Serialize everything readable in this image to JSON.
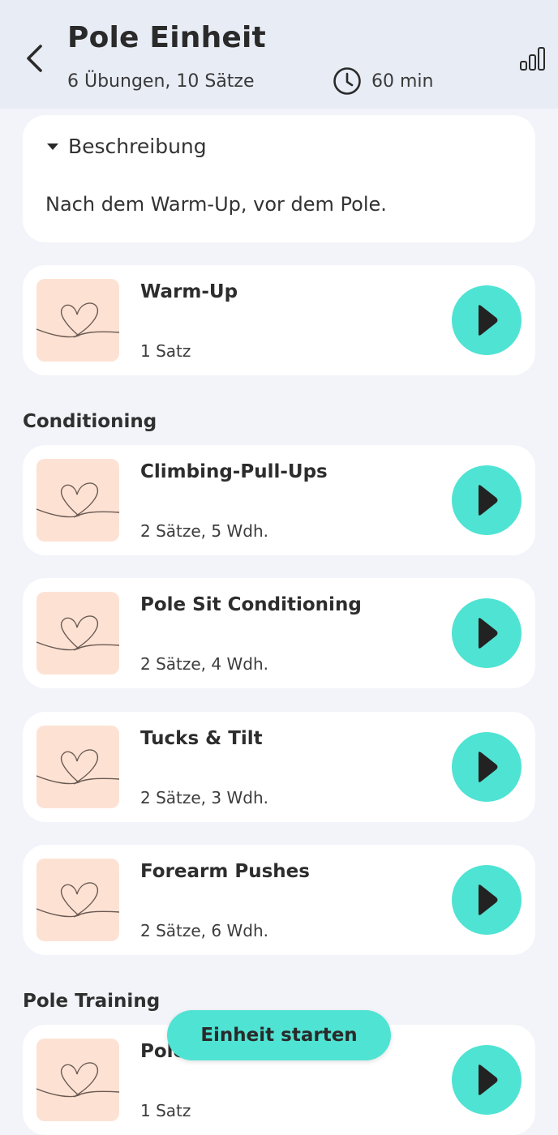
{
  "header": {
    "title": "Pole Einheit",
    "summary": "6 Übungen, 10 Sätze",
    "duration": "60 min",
    "back_icon": "chevron-left-icon",
    "level_icon": "signal-bars-icon"
  },
  "description": {
    "toggle_label": "Beschreibung",
    "text": "Nach dem Warm-Up, vor dem Pole."
  },
  "sections": {
    "conditioning": "Conditioning",
    "pole_training": "Pole Training"
  },
  "exercises": [
    {
      "name": "Warm-Up",
      "meta": "1 Satz"
    },
    {
      "name": "Climbing-Pull-Ups",
      "meta": "2 Sätze, 5 Wdh."
    },
    {
      "name": "Pole Sit Conditioning",
      "meta": "2 Sätze, 4 Wdh."
    },
    {
      "name": "Tucks & Tilt",
      "meta": "2 Sätze, 3 Wdh."
    },
    {
      "name": "Forearm Pushes",
      "meta": "2 Sätze, 6 Wdh."
    },
    {
      "name": "Pole Dance Einheit",
      "meta": "1 Satz"
    }
  ],
  "start_button": "Einheit starten",
  "colors": {
    "accent": "#4fe3d3",
    "thumb_bg": "#fde2d4",
    "header_bg": "#e8ecf5",
    "page_bg": "#f2f4f9"
  }
}
